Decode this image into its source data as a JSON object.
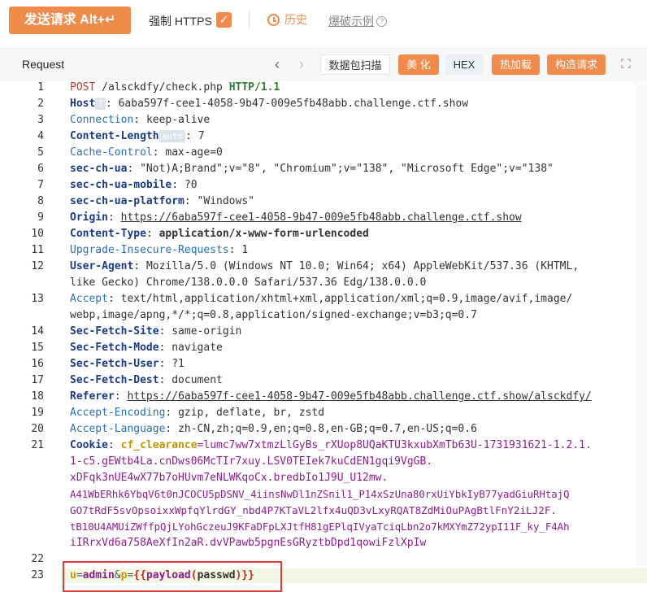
{
  "toolbar": {
    "send_label": "发送请求 Alt+↵",
    "https_label": "强制 HTTPS",
    "https_checked": "✓",
    "history_label": "历史",
    "examples_label": "爆破示例",
    "help_mark": "?"
  },
  "panel": {
    "title": "Request",
    "scan_label": "数据包扫描",
    "beautify_label": "美 化",
    "hex_label": "HEX",
    "hotload_label": "热加载",
    "build_label": "构造请求"
  },
  "request": {
    "line_numbers": [
      "1",
      "2",
      "3",
      "4",
      "5",
      "6",
      "7",
      "8",
      "9",
      "10",
      "11",
      "12",
      "13",
      "14",
      "15",
      "16",
      "17",
      "18",
      "19",
      "20",
      "21",
      "22",
      "23"
    ],
    "method": "POST",
    "path": "/alsckdfy/check.php",
    "protocol": "HTTP/1.1",
    "host_key": "Host",
    "host_badge": "?",
    "host_val": "6aba597f-cee1-4058-9b47-009e5fb48abb.challenge.ctf.show",
    "connection_key": "Connection",
    "connection_val": "keep-alive",
    "content_length_key": "Content-Length",
    "content_length_badge": "auto",
    "content_length_val": "7",
    "cache_control_key": "Cache-Control",
    "cache_control_val": "max-age=0",
    "sec_ch_ua_key": "sec-ch-ua",
    "sec_ch_ua_val": "\"Not)A;Brand\";v=\"8\", \"Chromium\";v=\"138\", \"Microsoft Edge\";v=\"138\"",
    "sec_ch_ua_mobile_key": "sec-ch-ua-mobile",
    "sec_ch_ua_mobile_val": "?0",
    "sec_ch_ua_platform_key": "sec-ch-ua-platform",
    "sec_ch_ua_platform_val": "\"Windows\"",
    "origin_key": "Origin",
    "origin_val": "https://6aba597f-cee1-4058-9b47-009e5fb48abb.challenge.ctf.show",
    "content_type_key": "Content-Type",
    "content_type_val": "application/x-www-form-urlencoded",
    "upgrade_key": "Upgrade-Insecure-Requests",
    "upgrade_val": "1",
    "user_agent_key": "User-Agent",
    "user_agent_val_1": "Mozilla/5.0 (Windows NT 10.0; Win64; x64) AppleWebKit/537.36 (KHTML,",
    "user_agent_val_2": "like Gecko) Chrome/138.0.0.0 Safari/537.36 Edg/138.0.0.0",
    "accept_key": "Accept",
    "accept_val_1": "text/html,application/xhtml+xml,application/xml;q=0.9,image/avif,image/",
    "accept_val_2": "webp,image/apng,*/*;q=0.8,application/signed-exchange;v=b3;q=0.7",
    "fetch_site_key": "Sec-Fetch-Site",
    "fetch_site_val": "same-origin",
    "fetch_mode_key": "Sec-Fetch-Mode",
    "fetch_mode_val": "navigate",
    "fetch_user_key": "Sec-Fetch-User",
    "fetch_user_val": "?1",
    "fetch_dest_key": "Sec-Fetch-Dest",
    "fetch_dest_val": "document",
    "referer_key": "Referer",
    "referer_val": "https://6aba597f-cee1-4058-9b47-009e5fb48abb.challenge.ctf.show/alsckdfy/",
    "accept_encoding_key": "Accept-Encoding",
    "accept_encoding_val": "gzip, deflate, br, zstd",
    "accept_language_key": "Accept-Language",
    "accept_language_val": "zh-CN,zh;q=0.9,en;q=0.8,en-GB;q=0.7,en-US;q=0.6",
    "cookie_key": "Cookie",
    "cookie_name": "cf_clearance",
    "cookie_lines": [
      "=lumc7ww7xtmzLlGyBs_rXUop8UQaKTU3kxubXmTb63U-1731931621-1.2.1.",
      "1-c5.gEWtb4La.cnDws06McTIr7xuy.LSV0TEIek7kuCdEN1gqi9VgGB.",
      "xDFqk3nUE4wX77b7oHUvm7eNLWKqoCx.bredbIo1J9U_U12mw.",
      "A41WbERhk6YbqV6t0nJCOCU5pDSNV_4iinsNwDl1nZSnil1_P14xSzUna80rxUiYbkIyB77yadGiuRHtajQ",
      "GO7tRdF5svOpsoixxWpfqYlrdGY_nbd4P7KTaVL2lfx4uQD3vLxyRQAT8ZdMiOuPAgBtlFnY2iLJ2F.",
      "tB10U4AMUiZWffpQjLYohGczeuJ9KFaDFpLXJtfH81gEPlqIVyaTciqLbn2o7kMXYmZ72ypI11F_ky_F4Ah",
      "iIRrxVd6a758AeXfIn2aR.dvVPawb5pgnEsGRyztbDpd1qowiFzlXpIw"
    ],
    "body_key_u": "u",
    "body_val_u": "admin",
    "body_amp": "&",
    "body_key_p": "p",
    "body_eq": "=",
    "body_open": "{{",
    "body_fn": "payload",
    "body_lparen": "(",
    "body_arg": "passwd",
    "body_rparen": ")",
    "body_close": "}}"
  }
}
